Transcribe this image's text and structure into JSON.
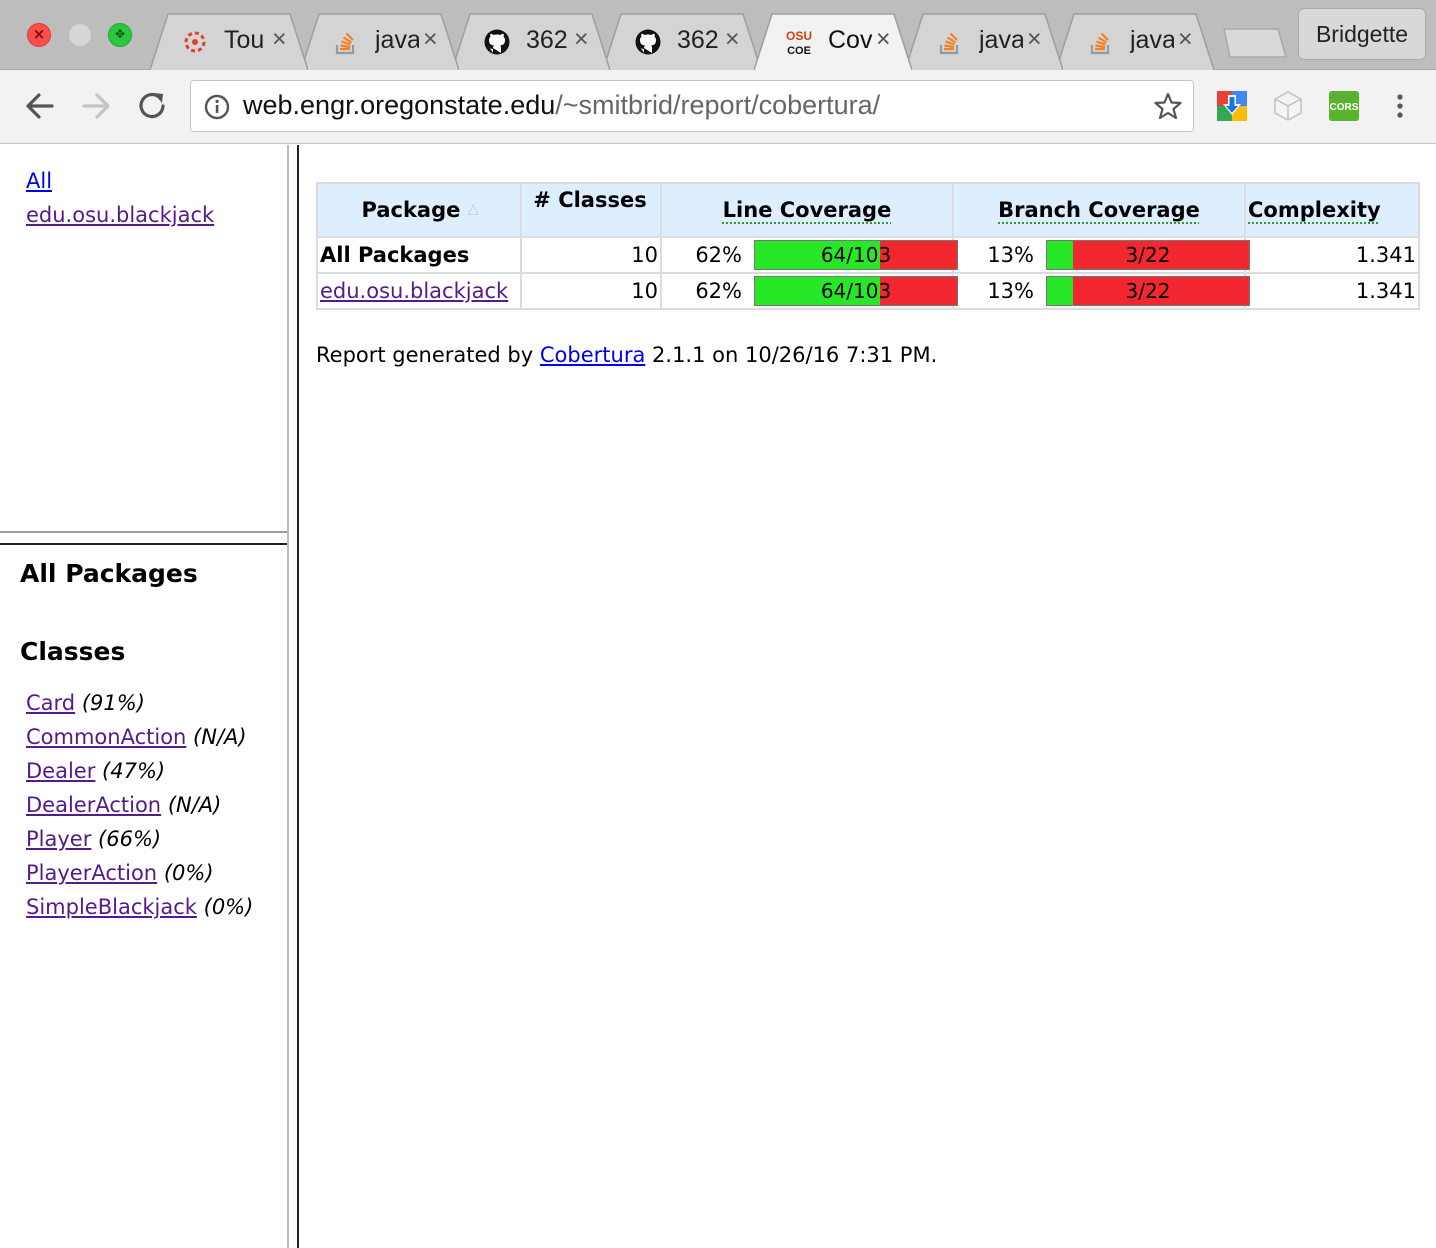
{
  "browser": {
    "tabs": [
      {
        "title": "Tou",
        "icon": "canvas-icon"
      },
      {
        "title": "java",
        "icon": "stackoverflow-icon"
      },
      {
        "title": "362",
        "icon": "github-icon"
      },
      {
        "title": "362",
        "icon": "github-icon"
      },
      {
        "title": "Cov",
        "icon": "osu-coe-icon",
        "active": true
      },
      {
        "title": "java",
        "icon": "stackoverflow-icon"
      },
      {
        "title": "java",
        "icon": "stackoverflow-icon"
      }
    ],
    "tab_close_glyph": "×",
    "profile_name": "Bridgette",
    "url_host": "web.engr.oregonstate.edu",
    "url_path": "/~smitbrid/report/cobertura/",
    "osu_favicon_top": "OSU",
    "osu_favicon_bottom": "COE",
    "extension_cors_label": "CORS"
  },
  "left_top": {
    "links": [
      "All",
      "edu.osu.blackjack"
    ]
  },
  "left_bottom": {
    "package_heading": "All Packages",
    "classes_heading": "Classes",
    "classes": [
      {
        "name": "Card",
        "coverage": "(91%)"
      },
      {
        "name": "CommonAction",
        "coverage": "(N/A)"
      },
      {
        "name": "Dealer",
        "coverage": "(47%)"
      },
      {
        "name": "DealerAction",
        "coverage": "(N/A)"
      },
      {
        "name": "Player",
        "coverage": "(66%)"
      },
      {
        "name": "PlayerAction",
        "coverage": "(0%)"
      },
      {
        "name": "SimpleBlackjack",
        "coverage": "(0%)"
      }
    ]
  },
  "report": {
    "headers": {
      "package": "Package",
      "classes": "# Classes",
      "line": "Line Coverage",
      "branch": "Branch Coverage",
      "complexity": "Complexity"
    },
    "rows": [
      {
        "package": "All Packages",
        "classes": "10",
        "line_pct": "62%",
        "line_frac": "64/103",
        "line_ratio": 0.62,
        "branch_pct": "13%",
        "branch_frac": "3/22",
        "branch_ratio": 0.13,
        "complexity": "1.341"
      },
      {
        "package": "edu.osu.blackjack",
        "classes": "10",
        "line_pct": "62%",
        "line_frac": "64/103",
        "line_ratio": 0.62,
        "branch_pct": "13%",
        "branch_frac": "3/22",
        "branch_ratio": 0.13,
        "complexity": "1.341"
      }
    ],
    "footer_prefix": "Report generated by",
    "footer_link": "Cobertura",
    "footer_suffix": "2.1.1 on 10/26/16 7:31 PM."
  },
  "colors": {
    "covered": "#27e827",
    "uncovered": "#f2272f",
    "header_bg": "#dceeff",
    "visited_link": "#551a8b",
    "link": "#0000ee"
  }
}
